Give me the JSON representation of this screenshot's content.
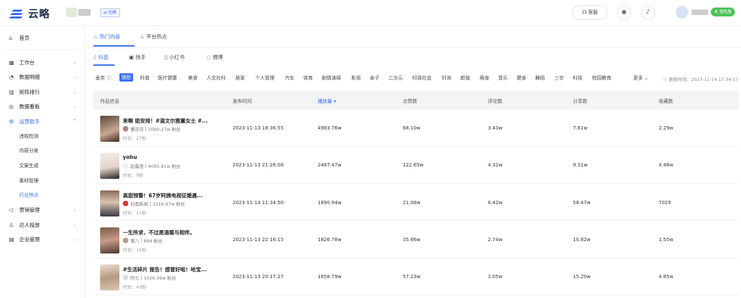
{
  "app": {
    "logo_text": "云略",
    "switch_label": "⇄ 切换",
    "kefu_label": "客服",
    "vip_label": "领先版"
  },
  "sidebar": {
    "home": "首页",
    "items": [
      {
        "label": "工作台",
        "icon": "grid-icon"
      },
      {
        "label": "数据明细",
        "icon": "chart-icon"
      },
      {
        "label": "矩阵排行",
        "icon": "bar-icon"
      },
      {
        "label": "数据看板",
        "icon": "dashboard-icon"
      },
      {
        "label": "运营助手",
        "icon": "gear-icon"
      },
      {
        "label": "营销管理",
        "icon": "speaker-icon"
      },
      {
        "label": "达人投放",
        "icon": "user-icon"
      },
      {
        "label": "企业管理",
        "icon": "building-icon"
      }
    ],
    "sub_items": [
      "违规检测",
      "内容分发",
      "文案生成",
      "素材管理",
      "行业热点"
    ]
  },
  "tabs_level1": [
    "热门内容",
    "平台热点"
  ],
  "tabs_level2": [
    "抖音",
    "快手",
    "小红书",
    "微博"
  ],
  "category_label": "垂类 ⓘ",
  "categories": [
    "随拍",
    "科普",
    "医疗健康",
    "美食",
    "人文社科",
    "居家",
    "个人管理",
    "汽车",
    "体育",
    "剧情演绎",
    "影视",
    "亲子",
    "二次元",
    "时政社会",
    "时尚",
    "颜值",
    "萌宠",
    "音乐",
    "健身",
    "舞蹈",
    "三农",
    "科技",
    "校园教育"
  ],
  "more_label": "更多 ⌄",
  "update_time": "更新时间：2023-11-14 17:34:17",
  "table": {
    "headers": [
      "作品信息",
      "发布时间",
      "播放量 ▾",
      "点赞数",
      "评论数",
      "分享数",
      "收藏数"
    ],
    "rows": [
      {
        "title": "来啊 姐安排！#温文尔雅董女士 #...",
        "author": "董亦亦",
        "fans": "1090.27w 粉丝",
        "duration": "时长：27秒",
        "time": "2023-11-13 18:36:55",
        "play": "4983.76w",
        "like": "68.10w",
        "comment": "3.43w",
        "share": "7.81w",
        "collect": "2.29w"
      },
      {
        "title": "yohu",
        "author": "赵露思",
        "fans": "4095.91w 粉丝",
        "duration": "时长：9秒",
        "time": "2023-11-13 21:26:08",
        "play": "2487.47w",
        "like": "122.65w",
        "comment": "4.32w",
        "share": "9.31w",
        "collect": "4.46w"
      },
      {
        "title": "高甜预警！67岁阿姨电视征婚遇...",
        "author": "封面新闻",
        "fans": "3216.97w 粉丝",
        "duration": "时长：15秒",
        "time": "2023-11-14 11:34:50",
        "play": "1890.94w",
        "like": "21.08w",
        "comment": "6.42w",
        "share": "58.47w",
        "collect": "7029"
      },
      {
        "title": "一生所求，不过是温暖与相伴。",
        "author": "黄八",
        "fans": "894 粉丝",
        "duration": "时长：16秒",
        "time": "2023-11-13 22:16:15",
        "play": "1826.78w",
        "like": "35.66w",
        "comment": "2.74w",
        "share": "10.82w",
        "collect": "1.55w"
      },
      {
        "title": "#生活碎片 报告！感冒好啦！哈宝...",
        "author": "阿七",
        "fans": "1026.36w 粉丝",
        "duration": "时长：43秒",
        "time": "2023-11-13 20:17:27",
        "play": "1658.79w",
        "like": "57.23w",
        "comment": "2.05w",
        "share": "15.20w",
        "collect": "4.85w"
      }
    ]
  }
}
